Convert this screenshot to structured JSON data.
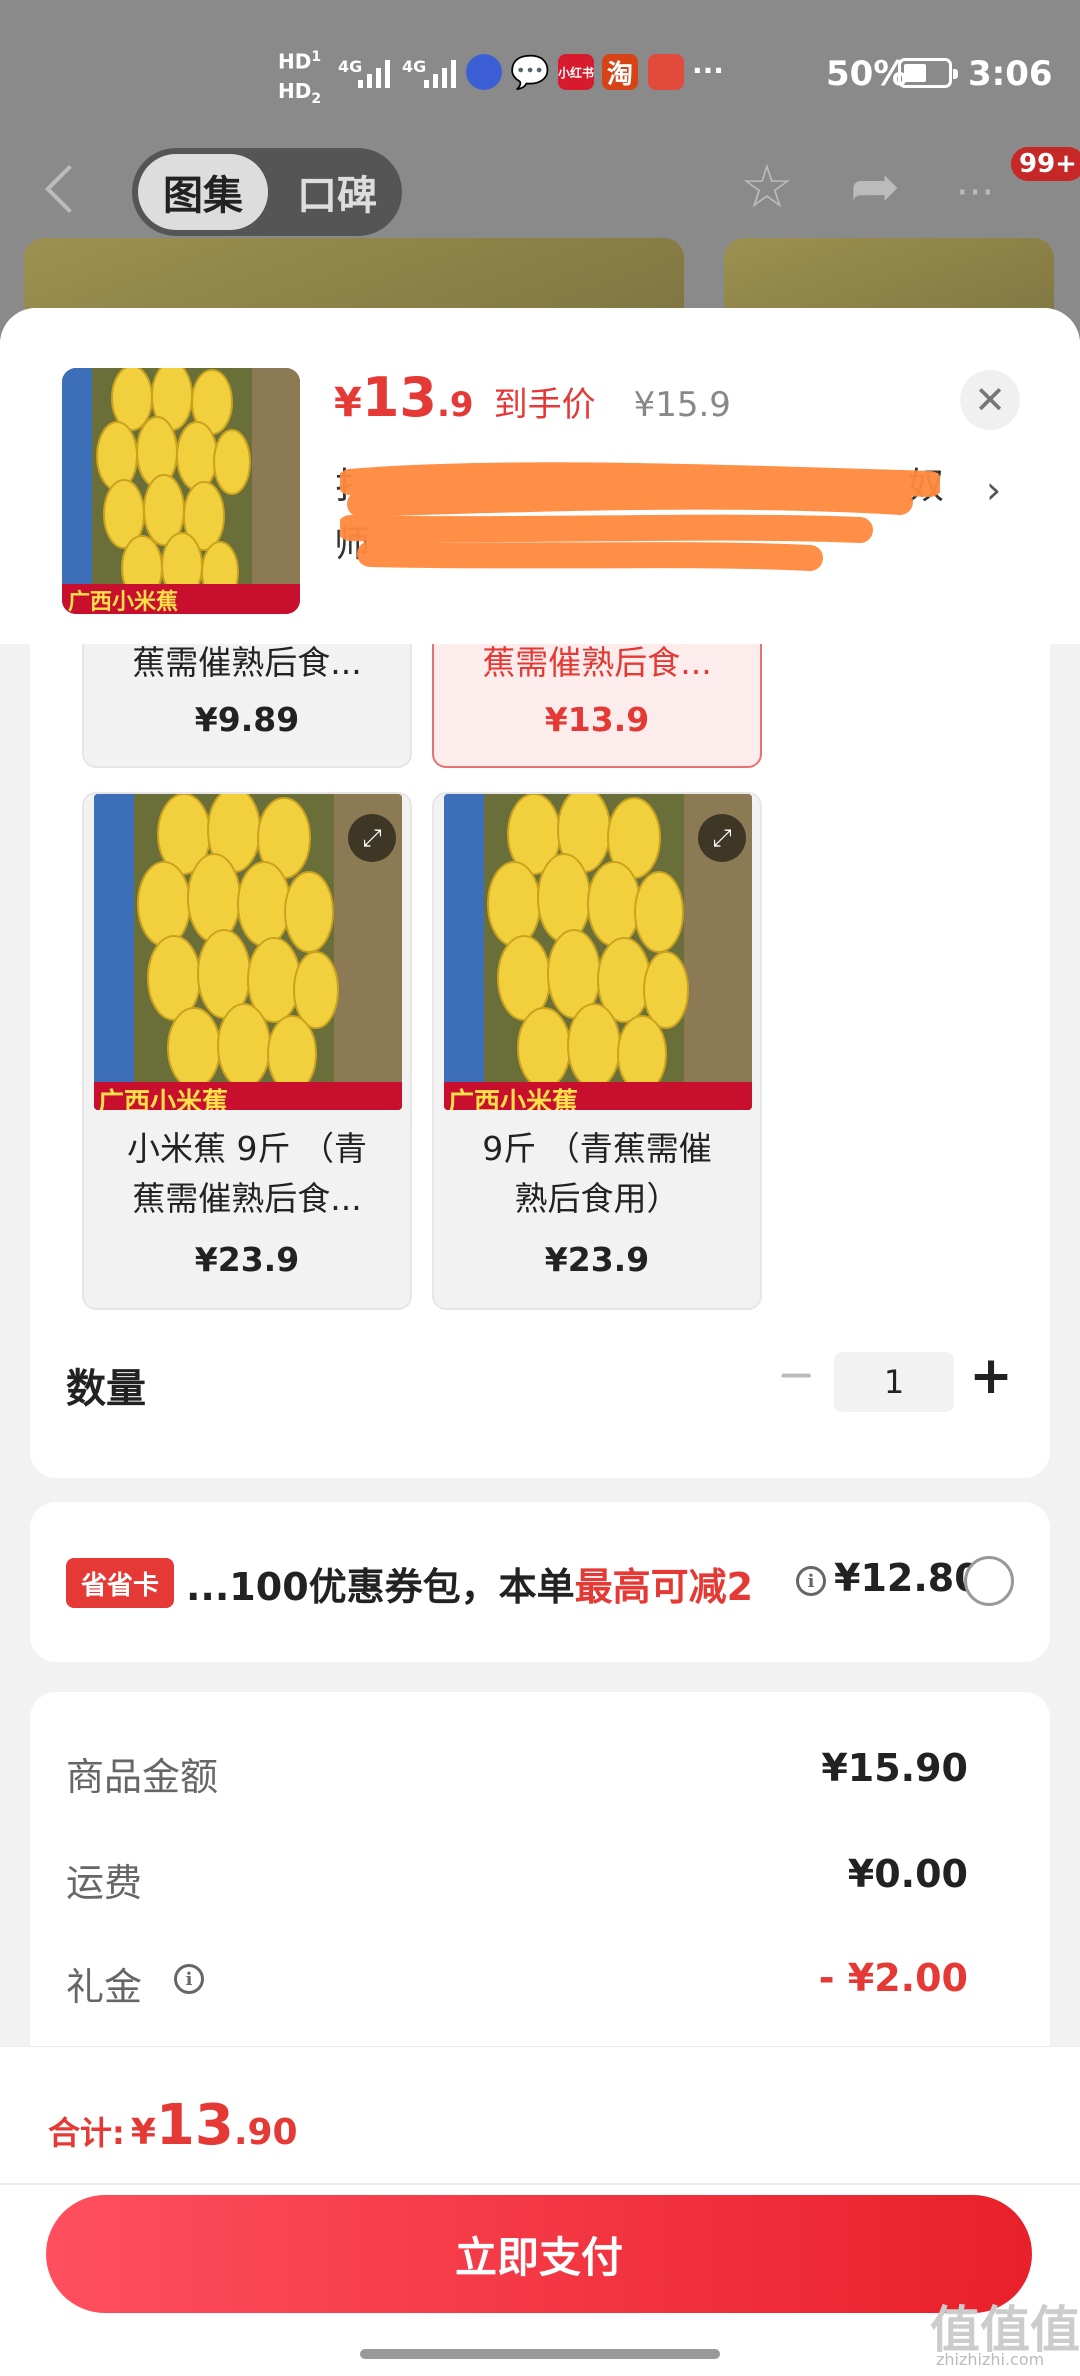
{
  "status_bar": {
    "hd1": "HD",
    "hd1_sub": "1",
    "hd2": "HD",
    "hd2_sub": "2",
    "net1": "4G",
    "net2": "4G",
    "app_icons": [
      "browser-icon",
      "message-icon",
      "xiaohongshu-icon",
      "taobao-icon",
      "game-icon"
    ],
    "app_xhs_label": "小红书",
    "app_tao_label": "淘",
    "more_dots": "···",
    "battery_text": "50%",
    "time": "3:06"
  },
  "background_nav": {
    "tab_active": "图集",
    "tab_inactive": "口碑",
    "badge": "99+"
  },
  "product": {
    "image_caption": "广西小米蕉",
    "price_symbol": "¥",
    "price_int": "13",
    "price_dec": ".9",
    "price_label": "到手价",
    "orig_price": "¥15.9",
    "spec_line1_start": "扌",
    "spec_line1_end": "奴",
    "spec_line2_start": "师"
  },
  "options": [
    {
      "name_line2": "蕉需催熟后食...",
      "price": "¥9.89",
      "selected": false
    },
    {
      "name_line2": "蕉需催熟后食...",
      "price": "¥13.9",
      "selected": true
    },
    {
      "caption": "广西小米蕉",
      "name_line1": "小米蕉 9斤 （青",
      "name_line2": "蕉需催熟后食...",
      "price": "¥23.9",
      "selected": false
    },
    {
      "caption": "广西小米蕉",
      "name_line1": "9斤 （青蕉需催",
      "name_line2": "熟后食用）",
      "price": "¥23.9",
      "selected": false
    }
  ],
  "quantity": {
    "label": "数量",
    "minus": "−",
    "value": "1",
    "plus": "+"
  },
  "coupon": {
    "tag": "省省卡",
    "text_prefix": "...100优惠券包，本单",
    "text_red": "最高可减2",
    "amount": "¥12.80"
  },
  "summary": {
    "rows": [
      {
        "label": "商品金额",
        "value": "¥15.90"
      },
      {
        "label": "运费",
        "value": "¥0.00"
      },
      {
        "label": "礼金",
        "value": "- ¥2.00"
      }
    ]
  },
  "footer": {
    "total_label": "合计:",
    "total_symbol": "¥",
    "total_int": "13",
    "total_dec": ".90",
    "pay_button": "立即支付",
    "watermark": "值值值",
    "watermark_site": "zhizhizhi.com"
  },
  "colors": {
    "accent": "#e53935",
    "banana": "#f2cf3c",
    "redact": "#ff8a3d"
  }
}
